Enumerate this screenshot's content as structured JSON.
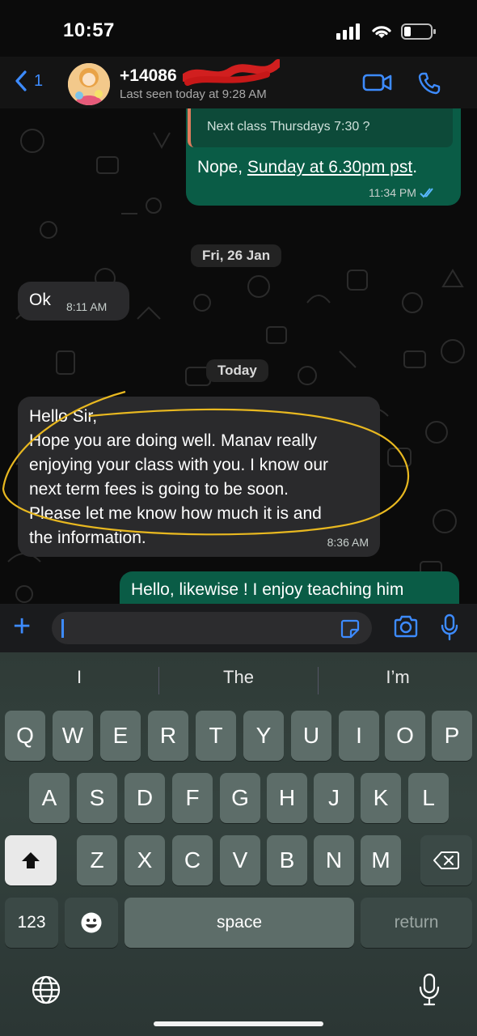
{
  "status_bar": {
    "time": "10:57"
  },
  "header": {
    "back_count": "1",
    "contact_name": "+14086",
    "last_seen": "Last seen today at 9:28 AM"
  },
  "messages": {
    "quoted_text": "Next class Thursdays 7:30 ?",
    "reply_prefix": "Nope, ",
    "reply_link": "Sunday at 6.30pm pst",
    "reply_suffix": ".",
    "reply_time": "11:34 PM",
    "date1": "Fri, 26 Jan",
    "ok_text": "Ok",
    "ok_time": "8:11 AM",
    "date2": "Today",
    "long_lines": [
      "Hello Sir,",
      "Hope you are doing well. Manav really",
      "enjoying your class with you. I know our",
      "next term fees is going to be soon.",
      "Please let me know how much it is and",
      "the information."
    ],
    "long_time": "8:36 AM",
    "last_text": "Hello, likewise ! I enjoy teaching him"
  },
  "keyboard": {
    "suggestions": [
      "I",
      "The",
      "I’m"
    ],
    "row1": [
      "Q",
      "W",
      "E",
      "R",
      "T",
      "Y",
      "U",
      "I",
      "O",
      "P"
    ],
    "row2": [
      "A",
      "S",
      "D",
      "F",
      "G",
      "H",
      "J",
      "K",
      "L"
    ],
    "row3": [
      "Z",
      "X",
      "C",
      "V",
      "B",
      "N",
      "M"
    ],
    "numbers_label": "123",
    "space_label": "space",
    "return_label": "return"
  },
  "colors": {
    "accent": "#3d8bff",
    "outgoing_bubble": "#0a5c46",
    "incoming_bubble": "#2a2a2c",
    "highlight_ellipse": "#e8b820"
  }
}
